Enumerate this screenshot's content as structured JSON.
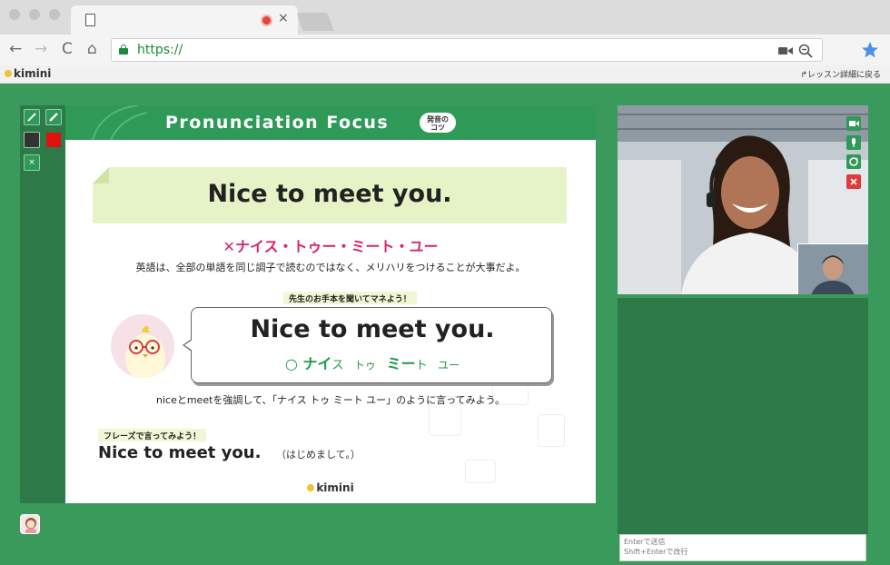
{
  "browser": {
    "url": "https://",
    "tab_close": "×",
    "nav": {
      "back": "←",
      "forward": "→",
      "reload": "C",
      "home": "⌂"
    },
    "icons": {
      "camera": "camera-icon",
      "zoom": "zoom-icon",
      "star": "star-icon"
    }
  },
  "app": {
    "logo": "kimini",
    "back_link": "レッスン詳細に戻る",
    "back_arrow": "↱"
  },
  "tools": {
    "clear_label": "×"
  },
  "slide": {
    "title": "Pronunciation Focus",
    "tip_badge_line1": "発音の",
    "tip_badge_line2": "コツ",
    "banner_text": "Nice to meet you.",
    "wrong_mark": "✕",
    "wrong_reading": "ナイス・トゥー・ミート・ユー",
    "explanation": "英語は、全部の単語を同じ調子で読むのではなく、メリハリをつけることが大事だよ。",
    "listen_label": "先生のお手本を聞いてマネよう！",
    "bubble_main": "Nice to meet you.",
    "bubble_mark": "○",
    "bubble_reading_1": "ナイ",
    "bubble_reading_2": "ス",
    "bubble_reading_3": "トゥ",
    "bubble_reading_4": "ミー",
    "bubble_reading_5": "ト",
    "bubble_reading_6": "ユー",
    "emphasis_note": "niceとmeetを強調して、「ナイス トゥ ミート ユー」のように言ってみよう。",
    "phrase_label": "フレーズで言ってみよう！",
    "phrase": "Nice to meet you.",
    "phrase_translation": "（はじめまして。）",
    "footer_logo": "kimini"
  },
  "chat": {
    "placeholder_line1": "Enterで送信",
    "placeholder_line2": "Shift+Enterで改行"
  },
  "colors": {
    "page_bg": "#3a9a5c",
    "panel_dark": "#2d7a48",
    "header_green": "#2f9a57",
    "wrong_pink": "#d6266d",
    "reading_green": "#1f9a4a"
  }
}
